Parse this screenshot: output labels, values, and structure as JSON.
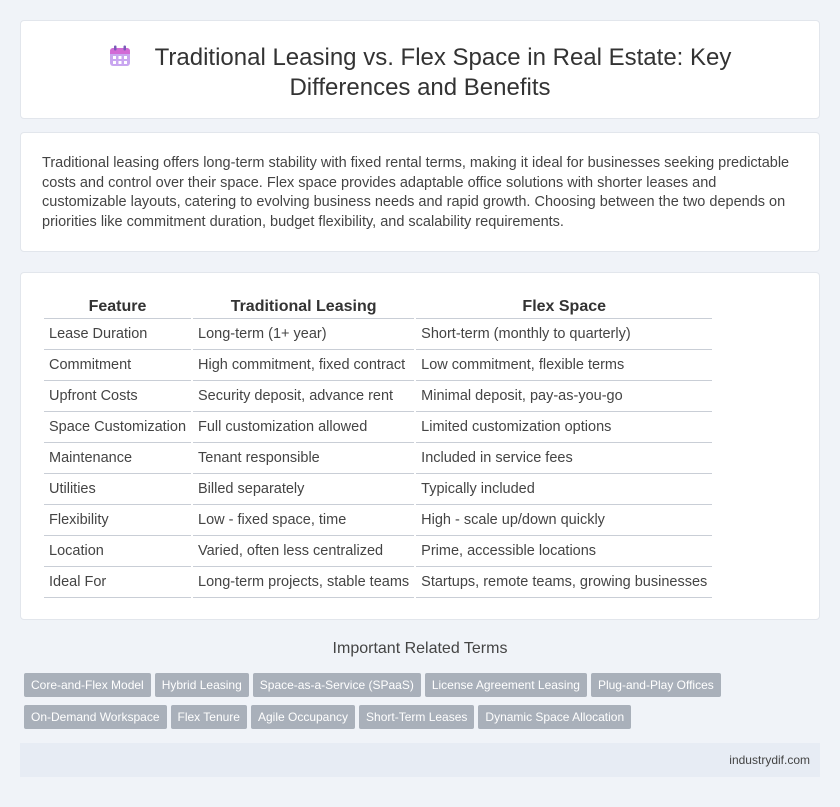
{
  "header": {
    "icon": "calendar-icon",
    "title": "Traditional Leasing vs. Flex Space in Real Estate: Key Differences and Benefits"
  },
  "intro": {
    "text": "Traditional leasing offers long-term stability with fixed rental terms, making it ideal for businesses seeking predictable costs and control over their space. Flex space provides adaptable office solutions with shorter leases and customizable layouts, catering to evolving business needs and rapid growth. Choosing between the two depends on priorities like commitment duration, budget flexibility, and scalability requirements."
  },
  "table": {
    "headers": [
      "Feature",
      "Traditional Leasing",
      "Flex Space"
    ],
    "rows": [
      [
        "Lease Duration",
        "Long-term (1+ year)",
        "Short-term (monthly to quarterly)"
      ],
      [
        "Commitment",
        "High commitment, fixed contract",
        "Low commitment, flexible terms"
      ],
      [
        "Upfront Costs",
        "Security deposit, advance rent",
        "Minimal deposit, pay-as-you-go"
      ],
      [
        "Space Customization",
        "Full customization allowed",
        "Limited customization options"
      ],
      [
        "Maintenance",
        "Tenant responsible",
        "Included in service fees"
      ],
      [
        "Utilities",
        "Billed separately",
        "Typically included"
      ],
      [
        "Flexibility",
        "Low - fixed space, time",
        "High - scale up/down quickly"
      ],
      [
        "Location",
        "Varied, often less centralized",
        "Prime, accessible locations"
      ],
      [
        "Ideal For",
        "Long-term projects, stable teams",
        "Startups, remote teams, growing businesses"
      ]
    ]
  },
  "related": {
    "title": "Important Related Terms",
    "row1": [
      "Core-and-Flex Model",
      "Hybrid Leasing",
      "Space-as-a-Service (SPaaS)",
      "License Agreement Leasing",
      "Plug-and-Play Offices"
    ],
    "row2": [
      "On-Demand Workspace",
      "Flex Tenure",
      "Agile Occupancy",
      "Short-Term Leases",
      "Dynamic Space Allocation"
    ]
  },
  "footer": {
    "site": "industrydif.com"
  },
  "colors": {
    "background": "#f0f3f8",
    "tag": "#a9b0ba",
    "footer": "#e7ecf4",
    "icon_top": "#d26bd6",
    "icon_body": "#c9a6f0"
  }
}
